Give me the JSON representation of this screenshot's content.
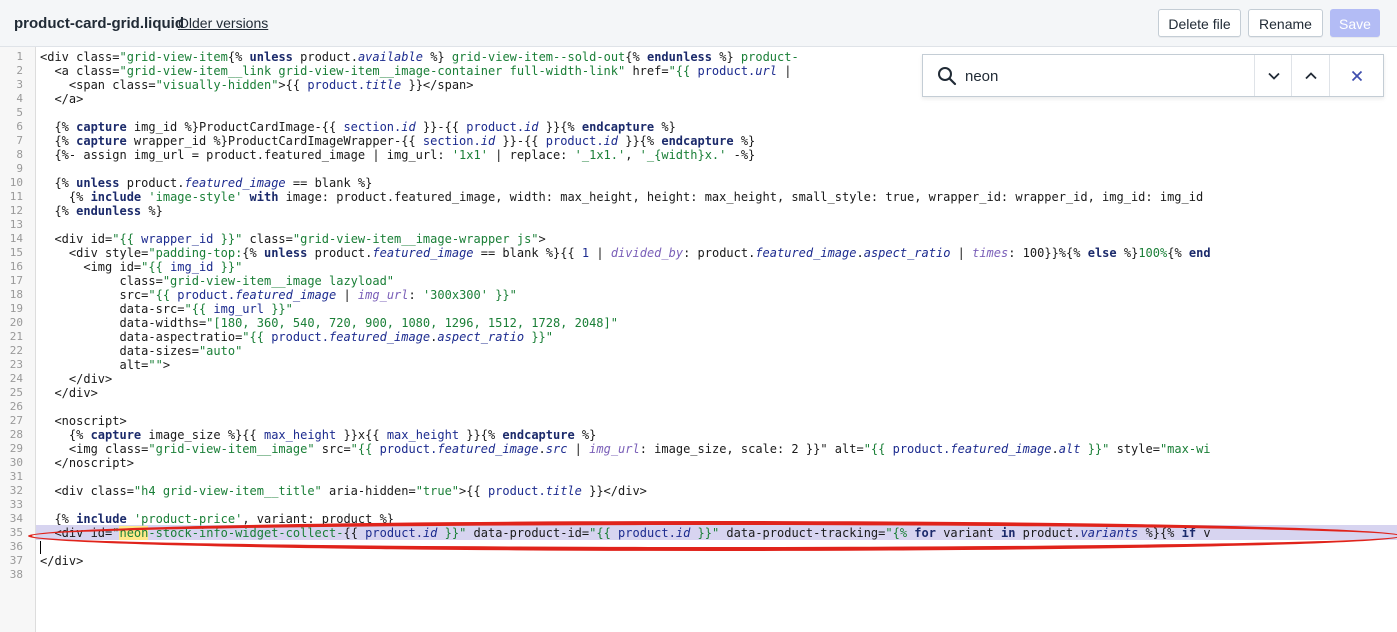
{
  "header": {
    "filename": "product-card-grid.liquid",
    "older_versions": "Older versions",
    "delete_label": "Delete file",
    "rename_label": "Rename",
    "save_label": "Save"
  },
  "search": {
    "value": "neon"
  },
  "editor": {
    "line_numbers": [
      "1",
      "2",
      "3",
      "4",
      "5",
      "6",
      "7",
      "8",
      "9",
      "10",
      "11",
      "12",
      "13",
      "14",
      "15",
      "16",
      "17",
      "18",
      "19",
      "20",
      "21",
      "22",
      "23",
      "24",
      "25",
      "26",
      "27",
      "28",
      "29",
      "30",
      "31",
      "32",
      "33",
      "34",
      "35",
      "36",
      "37",
      "38"
    ],
    "lines": [
      [
        {
          "t": "<div class=",
          "c": "n"
        },
        {
          "t": "\"grid-view-item",
          "c": "s"
        },
        {
          "t": "{% ",
          "c": "n"
        },
        {
          "t": "unless",
          "c": "k"
        },
        {
          "t": " product.",
          "c": "n"
        },
        {
          "t": "available",
          "c": "i"
        },
        {
          "t": " %}",
          "c": "n"
        },
        {
          "t": " grid-view-item--sold-out",
          "c": "s"
        },
        {
          "t": "{% ",
          "c": "n"
        },
        {
          "t": "endunless",
          "c": "k"
        },
        {
          "t": " %}",
          "c": "n"
        },
        {
          "t": " product-",
          "c": "s"
        }
      ],
      [
        {
          "t": "  <a class=",
          "c": "n"
        },
        {
          "t": "\"grid-view-item__link grid-view-item__image-container full-width-link\"",
          "c": "s"
        },
        {
          "t": " href=",
          "c": "n"
        },
        {
          "t": "\"{{ ",
          "c": "s"
        },
        {
          "t": "product.",
          "c": "v"
        },
        {
          "t": "url",
          "c": "i"
        },
        {
          "t": " |",
          "c": "n"
        }
      ],
      [
        {
          "t": "    <span class=",
          "c": "n"
        },
        {
          "t": "\"visually-hidden\"",
          "c": "s"
        },
        {
          "t": ">{{ ",
          "c": "n"
        },
        {
          "t": "product.",
          "c": "v"
        },
        {
          "t": "title",
          "c": "i"
        },
        {
          "t": " }}</span>",
          "c": "n"
        }
      ],
      [
        {
          "t": "  </a>",
          "c": "n"
        }
      ],
      [],
      [
        {
          "t": "  {% ",
          "c": "n"
        },
        {
          "t": "capture",
          "c": "k"
        },
        {
          "t": " img_id %}ProductCardImage-{{ ",
          "c": "n"
        },
        {
          "t": "section.",
          "c": "v"
        },
        {
          "t": "id",
          "c": "i"
        },
        {
          "t": " }}-{{ ",
          "c": "n"
        },
        {
          "t": "product.",
          "c": "v"
        },
        {
          "t": "id",
          "c": "i"
        },
        {
          "t": " }}{% ",
          "c": "n"
        },
        {
          "t": "endcapture",
          "c": "k"
        },
        {
          "t": " %}",
          "c": "n"
        }
      ],
      [
        {
          "t": "  {% ",
          "c": "n"
        },
        {
          "t": "capture",
          "c": "k"
        },
        {
          "t": " wrapper_id %}ProductCardImageWrapper-{{ ",
          "c": "n"
        },
        {
          "t": "section.",
          "c": "v"
        },
        {
          "t": "id",
          "c": "i"
        },
        {
          "t": " }}-{{ ",
          "c": "n"
        },
        {
          "t": "product.",
          "c": "v"
        },
        {
          "t": "id",
          "c": "i"
        },
        {
          "t": " }}{% ",
          "c": "n"
        },
        {
          "t": "endcapture",
          "c": "k"
        },
        {
          "t": " %}",
          "c": "n"
        }
      ],
      [
        {
          "t": "  {%- assign img_url = product.featured_image | img_url: ",
          "c": "n"
        },
        {
          "t": "'1x1'",
          "c": "s"
        },
        {
          "t": " | replace: ",
          "c": "n"
        },
        {
          "t": "'_1x1.'",
          "c": "s"
        },
        {
          "t": ", ",
          "c": "n"
        },
        {
          "t": "'_{width}x.'",
          "c": "s"
        },
        {
          "t": " -%}",
          "c": "n"
        }
      ],
      [],
      [
        {
          "t": "  {% ",
          "c": "n"
        },
        {
          "t": "unless",
          "c": "k"
        },
        {
          "t": " product.",
          "c": "n"
        },
        {
          "t": "featured_image",
          "c": "i"
        },
        {
          "t": " == blank %}",
          "c": "n"
        }
      ],
      [
        {
          "t": "    {% ",
          "c": "n"
        },
        {
          "t": "include",
          "c": "k"
        },
        {
          "t": " ",
          "c": "n"
        },
        {
          "t": "'image-style'",
          "c": "s"
        },
        {
          "t": " ",
          "c": "n"
        },
        {
          "t": "with",
          "c": "k"
        },
        {
          "t": " image: product.featured_image, width: max_height, height: max_height, small_style: true, wrapper_id: wrapper_id, img_id: img_id",
          "c": "n"
        }
      ],
      [
        {
          "t": "  {% ",
          "c": "n"
        },
        {
          "t": "endunless",
          "c": "k"
        },
        {
          "t": " %}",
          "c": "n"
        }
      ],
      [],
      [
        {
          "t": "  <div id=",
          "c": "n"
        },
        {
          "t": "\"{{ ",
          "c": "s"
        },
        {
          "t": "wrapper_id",
          "c": "v"
        },
        {
          "t": " }}\"",
          "c": "s"
        },
        {
          "t": " class=",
          "c": "n"
        },
        {
          "t": "\"grid-view-item__image-wrapper js\"",
          "c": "s"
        },
        {
          "t": ">",
          "c": "n"
        }
      ],
      [
        {
          "t": "    <div style=",
          "c": "n"
        },
        {
          "t": "\"padding-top:",
          "c": "s"
        },
        {
          "t": "{% ",
          "c": "n"
        },
        {
          "t": "unless",
          "c": "k"
        },
        {
          "t": " product.",
          "c": "n"
        },
        {
          "t": "featured_image",
          "c": "i"
        },
        {
          "t": " == blank %}{{ ",
          "c": "n"
        },
        {
          "t": "1",
          "c": "v"
        },
        {
          "t": " | ",
          "c": "n"
        },
        {
          "t": "divided_by",
          "c": "f"
        },
        {
          "t": ": product.",
          "c": "n"
        },
        {
          "t": "featured_image",
          "c": "i"
        },
        {
          "t": ".",
          "c": "n"
        },
        {
          "t": "aspect_ratio",
          "c": "i"
        },
        {
          "t": " | ",
          "c": "n"
        },
        {
          "t": "times",
          "c": "f"
        },
        {
          "t": ": 100}}%{% ",
          "c": "n"
        },
        {
          "t": "else",
          "c": "k"
        },
        {
          "t": " %}",
          "c": "n"
        },
        {
          "t": "100%",
          "c": "s"
        },
        {
          "t": "{% ",
          "c": "n"
        },
        {
          "t": "end",
          "c": "k"
        }
      ],
      [
        {
          "t": "      <img id=",
          "c": "n"
        },
        {
          "t": "\"{{ ",
          "c": "s"
        },
        {
          "t": "img_id",
          "c": "v"
        },
        {
          "t": " }}\"",
          "c": "s"
        }
      ],
      [
        {
          "t": "           class=",
          "c": "n"
        },
        {
          "t": "\"grid-view-item__image lazyload\"",
          "c": "s"
        }
      ],
      [
        {
          "t": "           src=",
          "c": "n"
        },
        {
          "t": "\"{{ ",
          "c": "s"
        },
        {
          "t": "product.",
          "c": "v"
        },
        {
          "t": "featured_image",
          "c": "i"
        },
        {
          "t": " | ",
          "c": "n"
        },
        {
          "t": "img_url",
          "c": "f"
        },
        {
          "t": ": ",
          "c": "n"
        },
        {
          "t": "'300x300'",
          "c": "s"
        },
        {
          "t": " }}\"",
          "c": "s"
        }
      ],
      [
        {
          "t": "           data-src=",
          "c": "n"
        },
        {
          "t": "\"{{ ",
          "c": "s"
        },
        {
          "t": "img_url",
          "c": "v"
        },
        {
          "t": " }}\"",
          "c": "s"
        }
      ],
      [
        {
          "t": "           data-widths=",
          "c": "n"
        },
        {
          "t": "\"[180, 360, 540, 720, 900, 1080, 1296, 1512, 1728, 2048]\"",
          "c": "s"
        }
      ],
      [
        {
          "t": "           data-aspectratio=",
          "c": "n"
        },
        {
          "t": "\"{{ ",
          "c": "s"
        },
        {
          "t": "product.",
          "c": "v"
        },
        {
          "t": "featured_image",
          "c": "i"
        },
        {
          "t": ".",
          "c": "n"
        },
        {
          "t": "aspect_ratio",
          "c": "i"
        },
        {
          "t": " }}\"",
          "c": "s"
        }
      ],
      [
        {
          "t": "           data-sizes=",
          "c": "n"
        },
        {
          "t": "\"auto\"",
          "c": "s"
        }
      ],
      [
        {
          "t": "           alt=",
          "c": "n"
        },
        {
          "t": "\"\"",
          "c": "s"
        },
        {
          "t": ">",
          "c": "n"
        }
      ],
      [
        {
          "t": "    </div>",
          "c": "n"
        }
      ],
      [
        {
          "t": "  </div>",
          "c": "n"
        }
      ],
      [],
      [
        {
          "t": "  <noscript>",
          "c": "n"
        }
      ],
      [
        {
          "t": "    {% ",
          "c": "n"
        },
        {
          "t": "capture",
          "c": "k"
        },
        {
          "t": " image_size %}{{ ",
          "c": "n"
        },
        {
          "t": "max_height",
          "c": "v"
        },
        {
          "t": " }}x{{ ",
          "c": "n"
        },
        {
          "t": "max_height",
          "c": "v"
        },
        {
          "t": " }}{% ",
          "c": "n"
        },
        {
          "t": "endcapture",
          "c": "k"
        },
        {
          "t": " %}",
          "c": "n"
        }
      ],
      [
        {
          "t": "    <img class=",
          "c": "n"
        },
        {
          "t": "\"grid-view-item__image\"",
          "c": "s"
        },
        {
          "t": " src=",
          "c": "n"
        },
        {
          "t": "\"{{ ",
          "c": "s"
        },
        {
          "t": "product.",
          "c": "v"
        },
        {
          "t": "featured_image",
          "c": "i"
        },
        {
          "t": ".",
          "c": "n"
        },
        {
          "t": "src",
          "c": "i"
        },
        {
          "t": " | ",
          "c": "n"
        },
        {
          "t": "img_url",
          "c": "f"
        },
        {
          "t": ": image_size, scale: 2 }}\"",
          "c": "n"
        },
        {
          "t": " alt=",
          "c": "n"
        },
        {
          "t": "\"{{ ",
          "c": "s"
        },
        {
          "t": "product.",
          "c": "v"
        },
        {
          "t": "featured_image",
          "c": "i"
        },
        {
          "t": ".",
          "c": "n"
        },
        {
          "t": "alt",
          "c": "i"
        },
        {
          "t": " }}\"",
          "c": "s"
        },
        {
          "t": " style=",
          "c": "n"
        },
        {
          "t": "\"max-wi",
          "c": "s"
        }
      ],
      [
        {
          "t": "  </noscript>",
          "c": "n"
        }
      ],
      [],
      [
        {
          "t": "  <div class=",
          "c": "n"
        },
        {
          "t": "\"h4 grid-view-item__title\"",
          "c": "s"
        },
        {
          "t": " aria-hidden=",
          "c": "n"
        },
        {
          "t": "\"true\"",
          "c": "s"
        },
        {
          "t": ">{{ ",
          "c": "n"
        },
        {
          "t": "product.",
          "c": "v"
        },
        {
          "t": "title",
          "c": "i"
        },
        {
          "t": " }}</div>",
          "c": "n"
        }
      ],
      [],
      [
        {
          "t": "  {% ",
          "c": "n"
        },
        {
          "t": "include",
          "c": "k"
        },
        {
          "t": " ",
          "c": "n"
        },
        {
          "t": "'product-price'",
          "c": "s"
        },
        {
          "t": ", variant: product %}",
          "c": "n"
        }
      ],
      [
        {
          "t": "  <div id=",
          "c": "n"
        },
        {
          "t": "\"",
          "c": "s"
        },
        {
          "t": "neon",
          "c": "m"
        },
        {
          "t": "-stock-info-widget-collect-",
          "c": "s"
        },
        {
          "t": "{{ ",
          "c": "n"
        },
        {
          "t": "product.",
          "c": "v"
        },
        {
          "t": "id",
          "c": "i"
        },
        {
          "t": " }}\"",
          "c": "s"
        },
        {
          "t": " data-product-id=",
          "c": "n"
        },
        {
          "t": "\"{{ ",
          "c": "s"
        },
        {
          "t": "product.",
          "c": "v"
        },
        {
          "t": "id",
          "c": "i"
        },
        {
          "t": " }}\"",
          "c": "s"
        },
        {
          "t": " data-product-tracking=",
          "c": "n"
        },
        {
          "t": "\"{% ",
          "c": "s"
        },
        {
          "t": "for",
          "c": "k"
        },
        {
          "t": " variant ",
          "c": "n"
        },
        {
          "t": "in",
          "c": "k"
        },
        {
          "t": " product.",
          "c": "n"
        },
        {
          "t": "variants",
          "c": "i"
        },
        {
          "t": " %}{% ",
          "c": "n"
        },
        {
          "t": "if",
          "c": "k"
        },
        {
          "t": " v",
          "c": "n"
        }
      ],
      [],
      [
        {
          "t": "</div>",
          "c": "n"
        }
      ],
      []
    ]
  }
}
